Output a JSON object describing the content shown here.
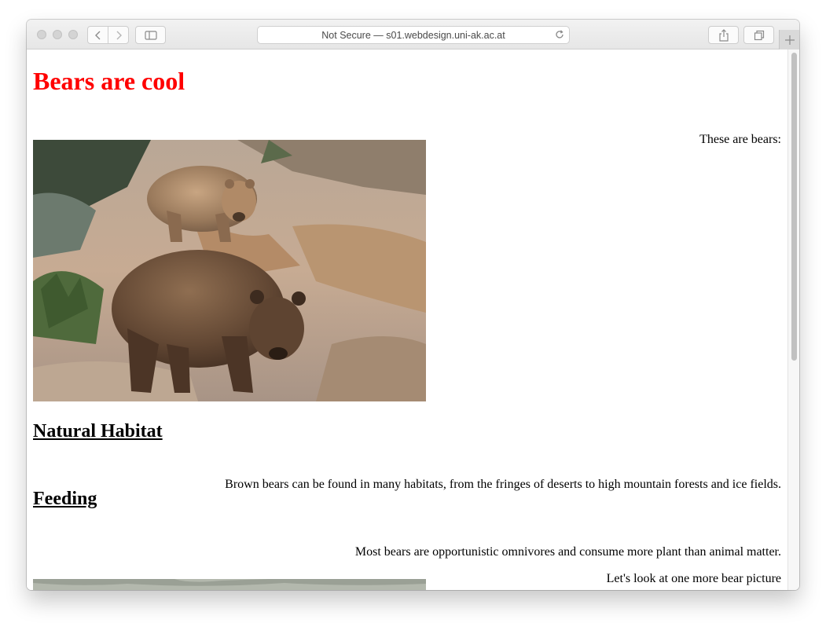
{
  "browser": {
    "address": "Not Secure — s01.webdesign.uni-ak.ac.at"
  },
  "page": {
    "heading": "Bears are cool",
    "intro": "These are bears:",
    "habitat_heading": "Natural Habitat",
    "habitat_text": "Brown bears can be found in many habitats, from the fringes of deserts to high mountain forests and ice fields.",
    "feeding_heading": "Feeding",
    "feeding_text": "Most bears are opportunistic omnivores and consume more plant than animal matter.",
    "more_text": "Let's look at one more bear picture"
  },
  "colors": {
    "heading": "#ff0000"
  }
}
